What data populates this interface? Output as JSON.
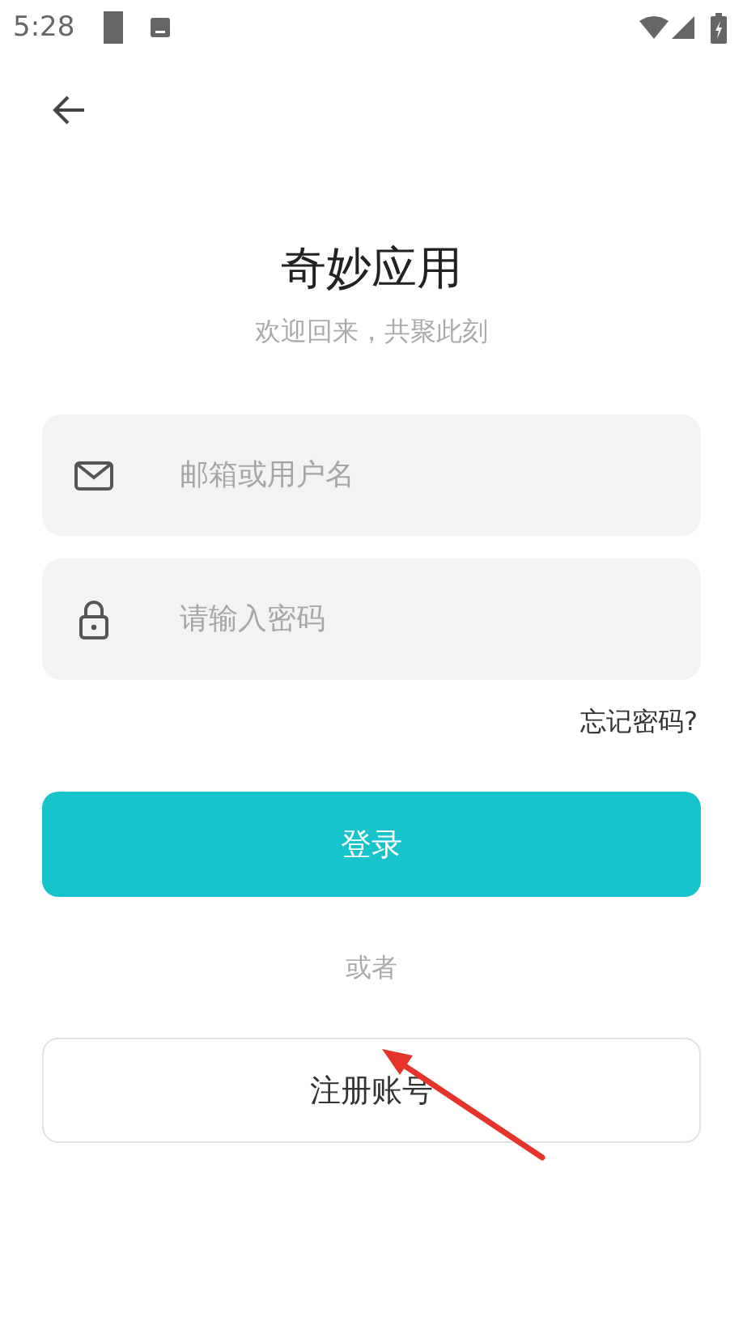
{
  "status_bar": {
    "time": "5:28"
  },
  "title": "奇妙应用",
  "subtitle": "欢迎回来，共聚此刻",
  "fields": [
    {
      "kind": "email",
      "placeholder": "邮箱或用户名"
    },
    {
      "kind": "password",
      "placeholder": "请输入密码"
    }
  ],
  "forgot_link": "忘记密码?",
  "login_button": "登录",
  "divider_text": "或者",
  "register_button": "注册账号"
}
